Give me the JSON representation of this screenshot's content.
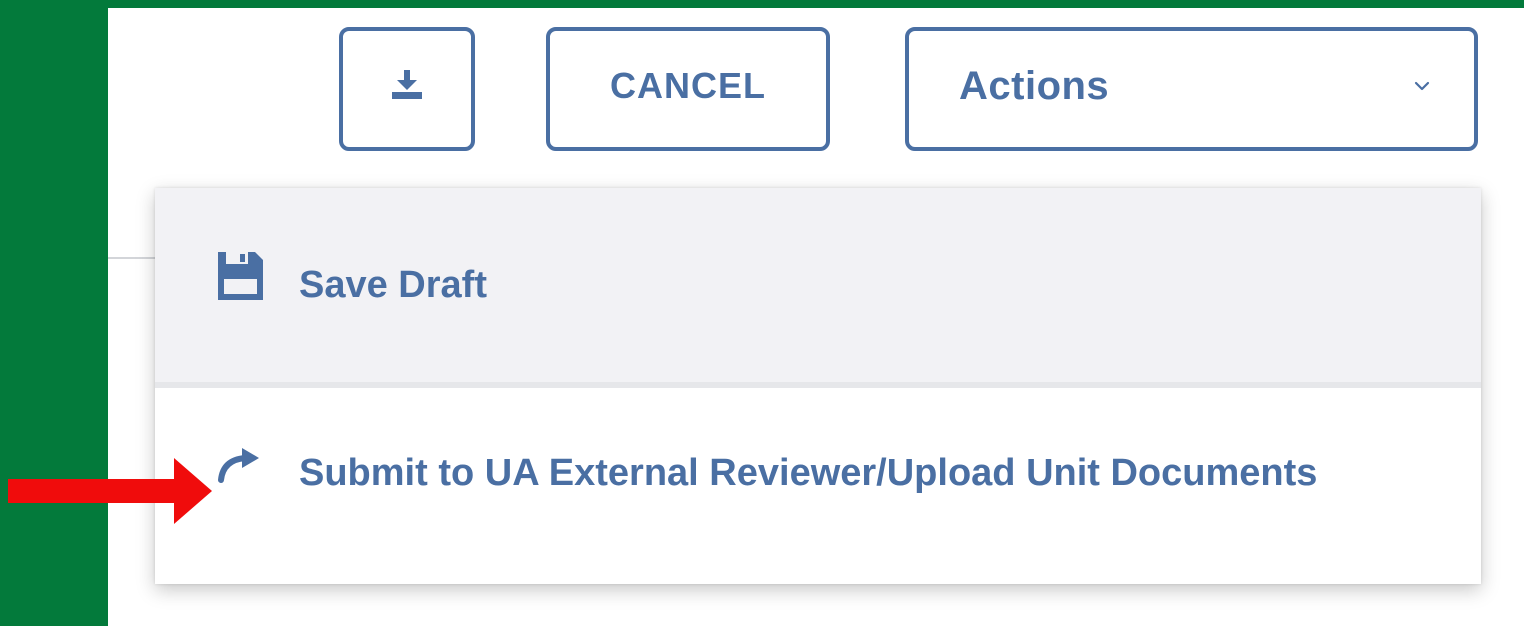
{
  "toolbar": {
    "download_icon": "download-icon",
    "cancel_label": "CANCEL",
    "actions_label": "Actions",
    "actions_chevron_icon": "chevron-down-icon"
  },
  "menu": {
    "items": [
      {
        "label": "Save Draft",
        "icon": "floppy-disk-icon"
      },
      {
        "label": "Submit to UA External Reviewer/Upload Unit Documents",
        "icon": "redo-arrow-icon"
      }
    ]
  },
  "annotation": {
    "arrow_color": "#f00c0c"
  },
  "colors": {
    "brand_green": "#037a3b",
    "accent_blue": "#4a6fa3",
    "menu_hover_bg": "#f2f2f5"
  }
}
